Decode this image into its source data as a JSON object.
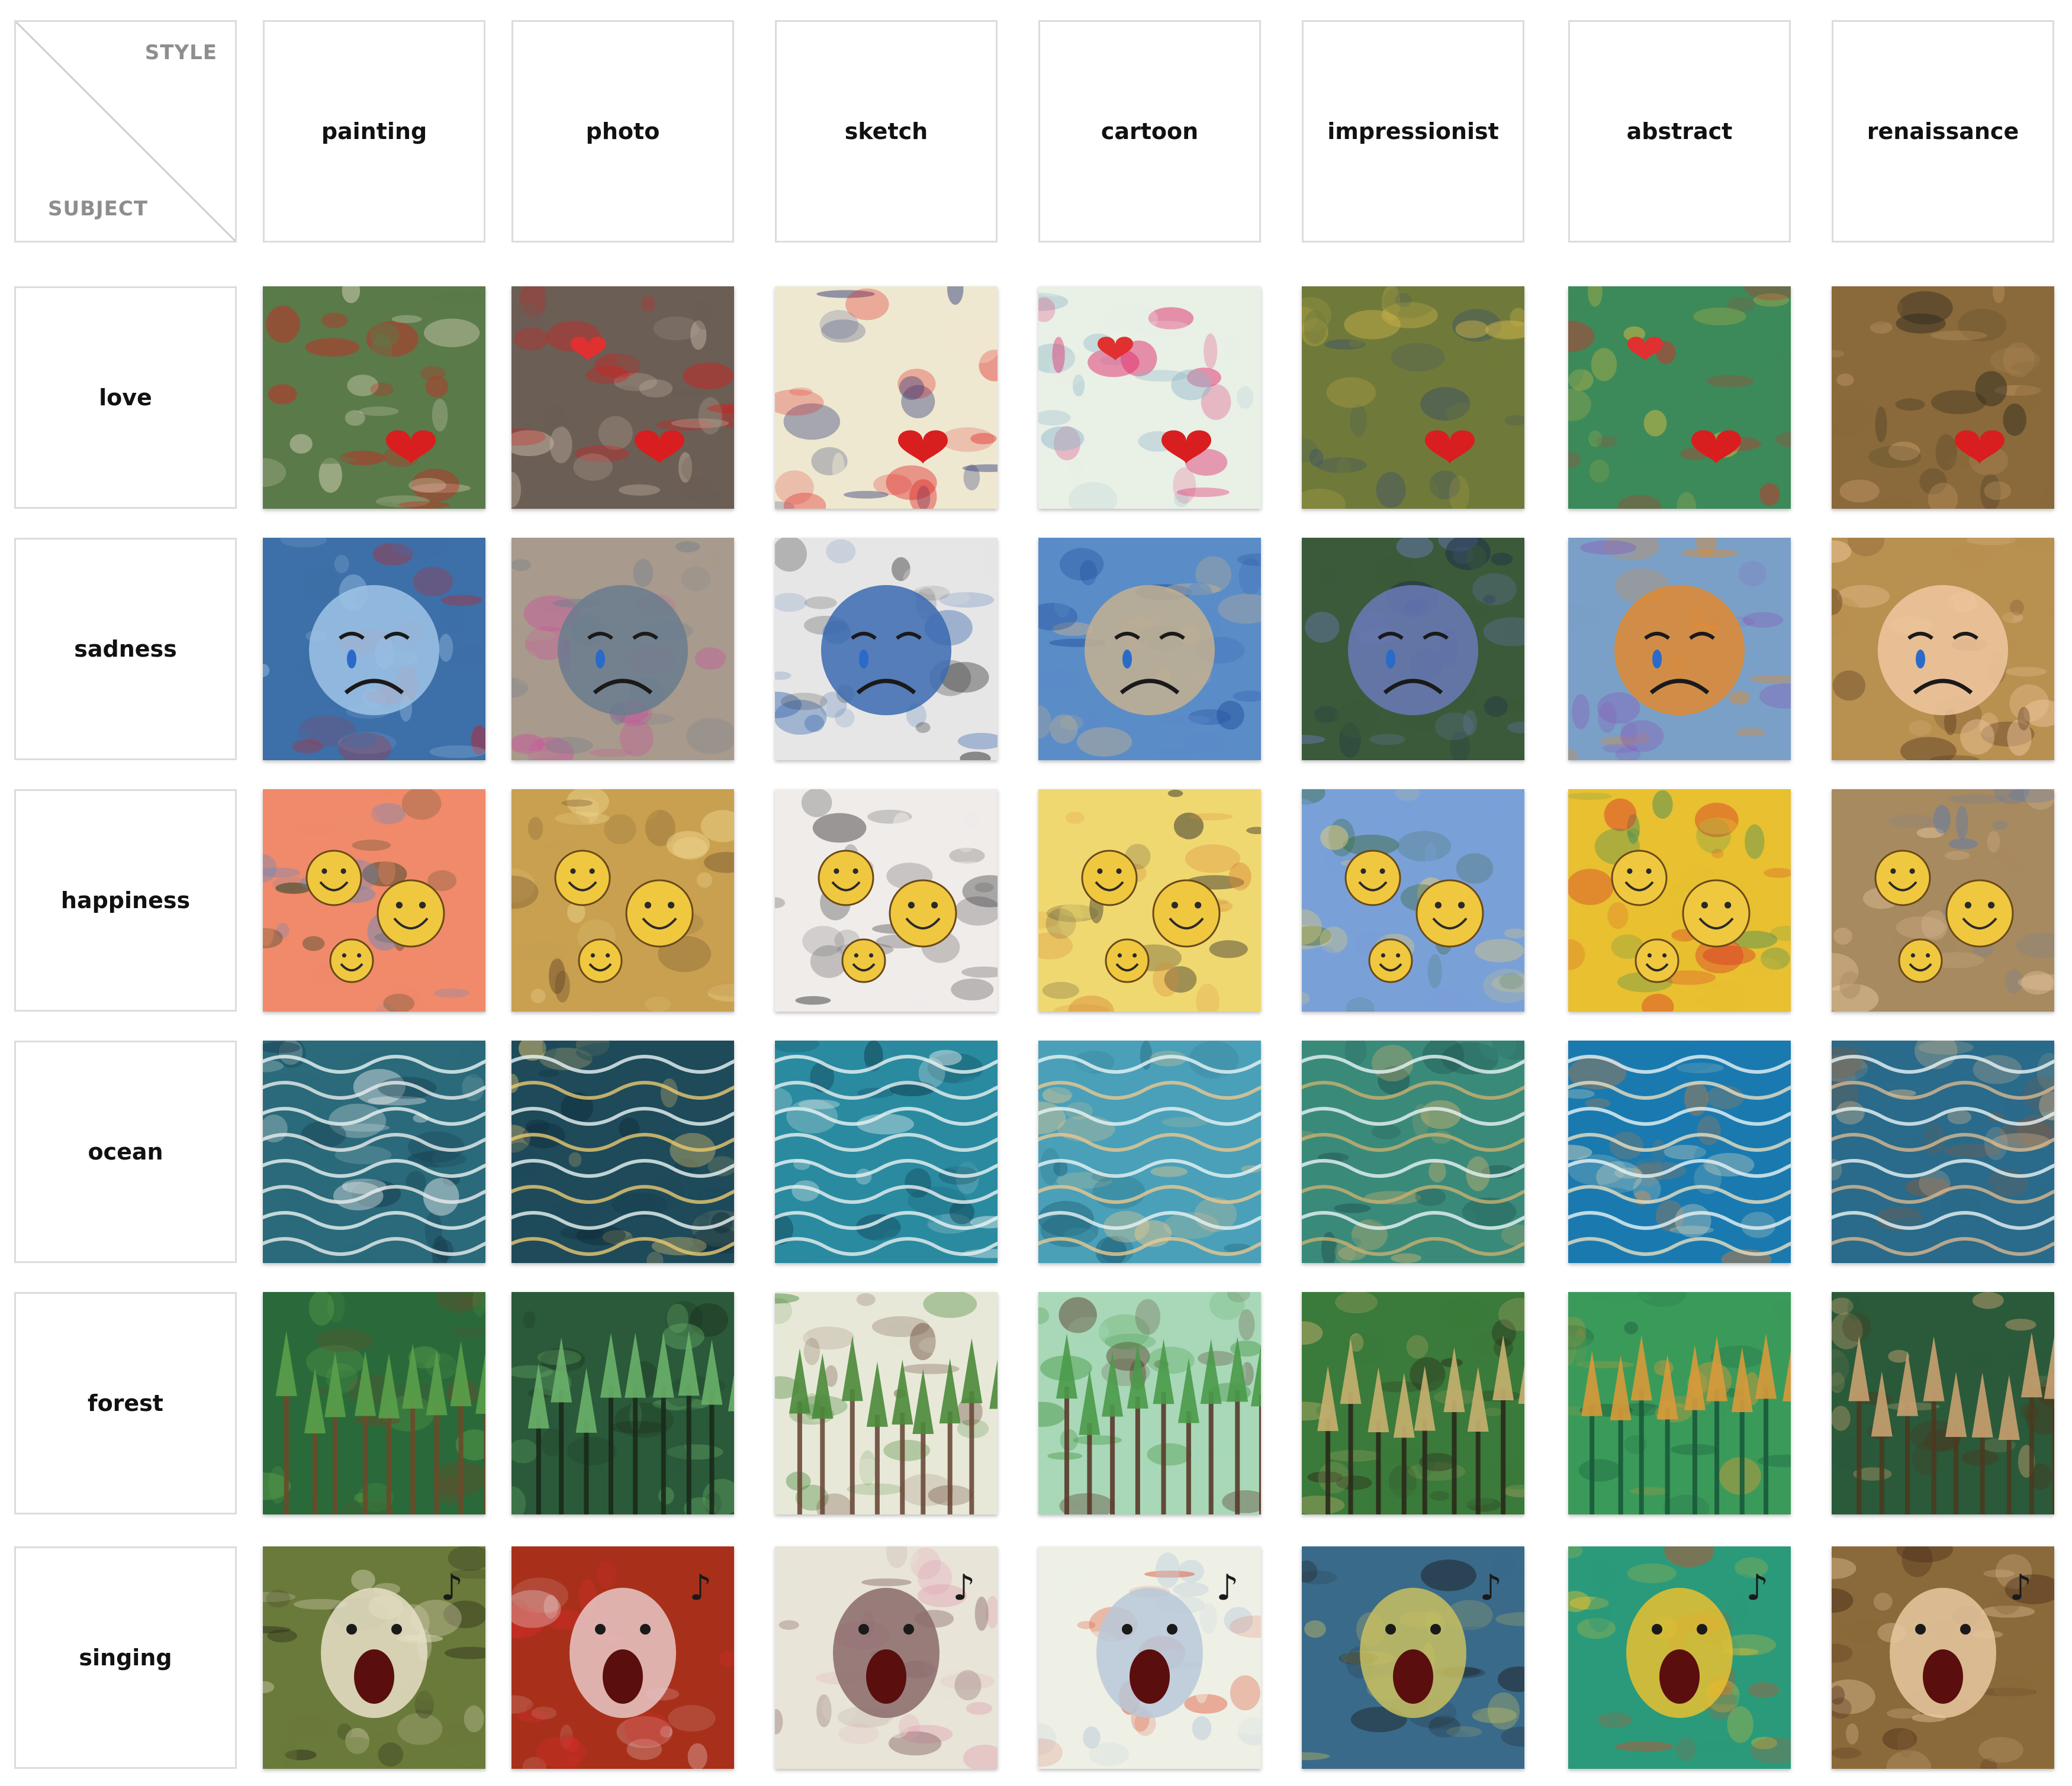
{
  "corner": {
    "style_label": "STYLE",
    "subject_label": "SUBJECT"
  },
  "styles": [
    "painting",
    "photo",
    "sketch",
    "cartoon",
    "impressionist",
    "abstract",
    "renaissance"
  ],
  "subjects": [
    "love",
    "sadness",
    "happiness",
    "ocean",
    "forest",
    "singing"
  ],
  "subject_icons": [
    "heart-icon",
    "tear-icon",
    "smile-icon",
    "wave-icon",
    "tree-icon",
    "music-note-icon"
  ]
}
